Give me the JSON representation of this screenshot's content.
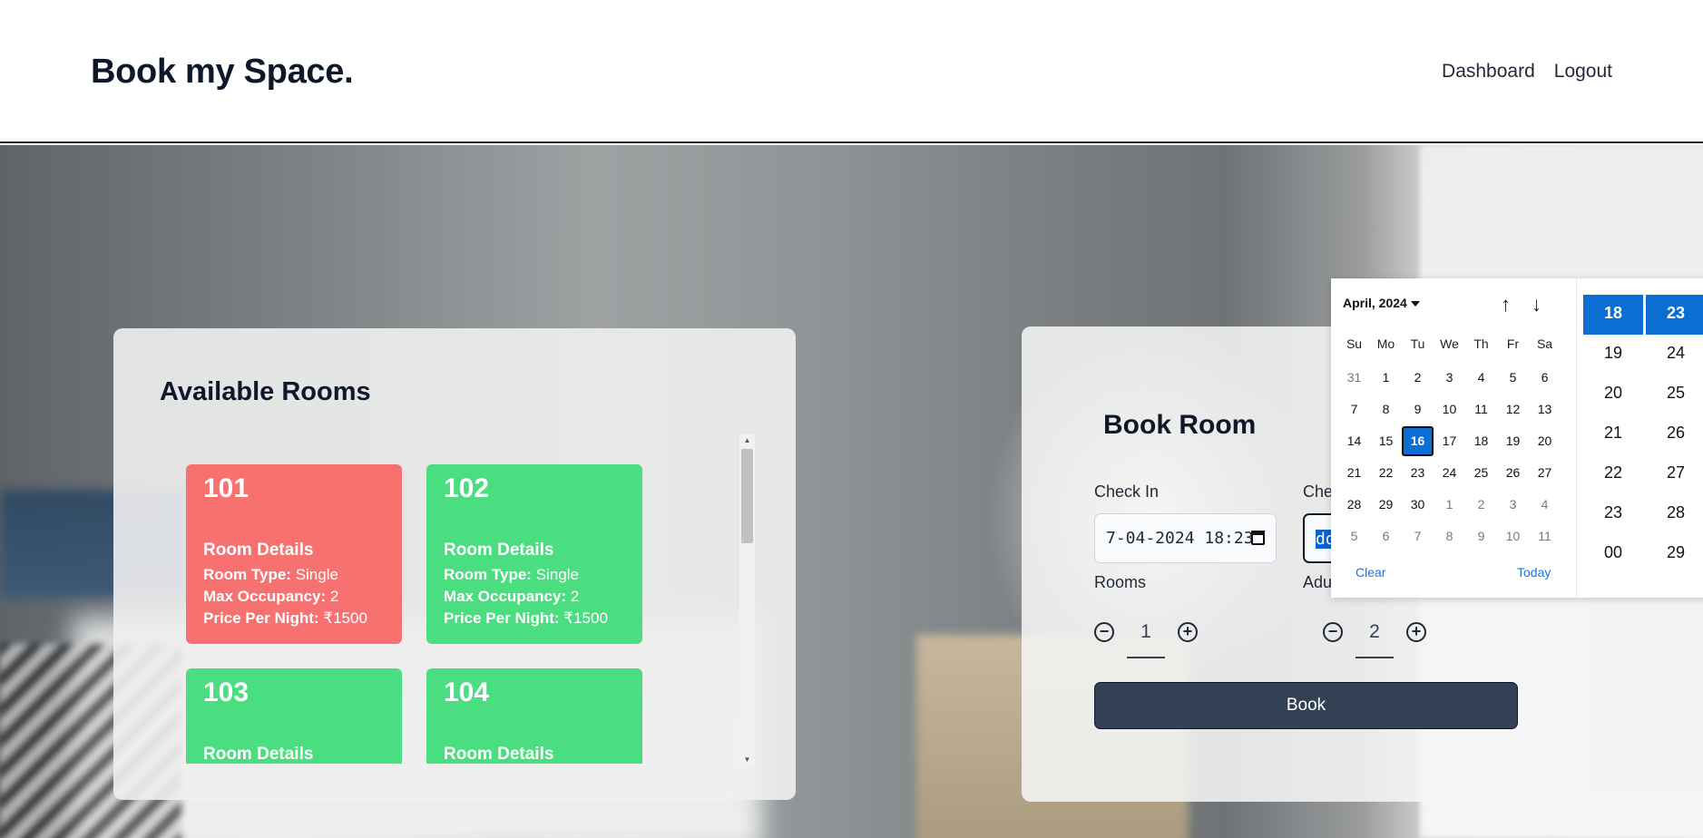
{
  "header": {
    "brand": "Book my Space.",
    "nav": {
      "dashboard": "Dashboard",
      "logout": "Logout"
    }
  },
  "available_rooms": {
    "title": "Available Rooms",
    "rooms": [
      {
        "number": "101",
        "status": "occupied",
        "color": "#f87171",
        "details_title": "Room Details",
        "type_label": "Room Type:",
        "type_value": " Single",
        "occupancy_label": "Max Occupancy:",
        "occupancy_value": " 2",
        "price_label": "Price Per Night:",
        "price_value": " ₹1500"
      },
      {
        "number": "102",
        "status": "available",
        "color": "#4ade80",
        "details_title": "Room Details",
        "type_label": "Room Type:",
        "type_value": " Single",
        "occupancy_label": "Max Occupancy:",
        "occupancy_value": " 2",
        "price_label": "Price Per Night:",
        "price_value": " ₹1500"
      },
      {
        "number": "103",
        "status": "available",
        "color": "#4ade80",
        "details_title": "Room Details"
      },
      {
        "number": "104",
        "status": "available",
        "color": "#4ade80",
        "details_title": "Room Details"
      }
    ]
  },
  "book_room": {
    "title": "Book Room",
    "check_in": {
      "label": "Check In",
      "value": "7-04-2024 18:23"
    },
    "check_out": {
      "label": "Che",
      "value_selected": "dd"
    },
    "rooms": {
      "label": "Rooms",
      "value": "1"
    },
    "adults": {
      "label": "Adu",
      "value": "2"
    },
    "book_button": "Book"
  },
  "date_picker": {
    "month_label": "April, 2024",
    "weekdays": [
      "Su",
      "Mo",
      "Tu",
      "We",
      "Th",
      "Fr",
      "Sa"
    ],
    "weeks": [
      [
        "31",
        "1",
        "2",
        "3",
        "4",
        "5",
        "6"
      ],
      [
        "7",
        "8",
        "9",
        "10",
        "11",
        "12",
        "13"
      ],
      [
        "14",
        "15",
        "16",
        "17",
        "18",
        "19",
        "20"
      ],
      [
        "21",
        "22",
        "23",
        "24",
        "25",
        "26",
        "27"
      ],
      [
        "28",
        "29",
        "30",
        "1",
        "2",
        "3",
        "4"
      ],
      [
        "5",
        "6",
        "7",
        "8",
        "9",
        "10",
        "11"
      ]
    ],
    "selected_day": "16",
    "clear_label": "Clear",
    "today_label": "Today",
    "hours": [
      "18",
      "19",
      "20",
      "21",
      "22",
      "23",
      "00"
    ],
    "minutes": [
      "23",
      "24",
      "25",
      "26",
      "27",
      "28",
      "29"
    ],
    "selected_hour": "18",
    "selected_minute": "23",
    "accent_color": "#0b6ed3"
  }
}
